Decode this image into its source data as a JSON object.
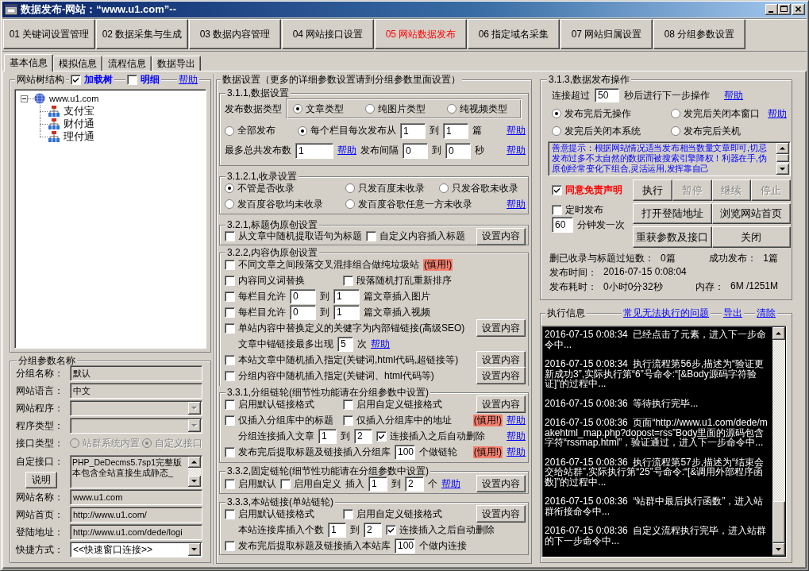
{
  "window": {
    "title": "数据发布-网站：“www.u1.com”--"
  },
  "module_tabs": [
    {
      "label": "01 关键词设置管理",
      "selected": false
    },
    {
      "label": "02 数据采集与生成",
      "selected": false
    },
    {
      "label": "03 数据内容管理",
      "selected": false
    },
    {
      "label": "04 网站接口设置",
      "selected": false
    },
    {
      "label": "05 网站数据发布",
      "selected": true
    },
    {
      "label": "06 指定域名采集",
      "selected": false
    },
    {
      "label": "07 网站归属设置",
      "selected": false
    },
    {
      "label": "08 分组参数设置",
      "selected": false
    }
  ],
  "tabs": [
    {
      "label": "基本信息",
      "selected": true
    },
    {
      "label": "模拟信息",
      "selected": false
    },
    {
      "label": "流程信息",
      "selected": false
    },
    {
      "label": "数据导出",
      "selected": false
    }
  ],
  "site_tree": {
    "title": "网站树结构",
    "options": [
      {
        "label": "加载树",
        "checked": true
      },
      {
        "label": "明细",
        "checked": false
      }
    ],
    "help": "帮助",
    "nodes": [
      {
        "label": "www.u1.com",
        "expanded": true,
        "children": [
          {
            "label": "支付宝"
          },
          {
            "label": "财付通"
          },
          {
            "label": "理付通"
          }
        ]
      }
    ]
  },
  "group_params": {
    "title": "分组参数名称",
    "fields": [
      {
        "kind": "text",
        "label": "分组名称：",
        "value": "默认",
        "readonly": true
      },
      {
        "kind": "text",
        "label": "网站语言：",
        "value": "中文",
        "readonly": true
      },
      {
        "kind": "select",
        "label": "网站程序：",
        "disabled": true
      },
      {
        "kind": "select",
        "label": "程序类型：",
        "disabled": true
      },
      {
        "kind": "radios",
        "label": "接口类型：",
        "disabled": true,
        "options": [
          {
            "label": "站群系统内置",
            "selected": false
          },
          {
            "label": "自定义接口",
            "selected": true
          }
        ]
      },
      {
        "kind": "memo",
        "label": "自定接口：",
        "lines": [
          "PHP_DeDecms5.7sp1完整版",
          "本包含全站直接生成静态_"
        ],
        "readonly": true,
        "button": "说明"
      },
      {
        "kind": "text",
        "label": "网站名称：",
        "value": "www.u1.com",
        "readonly": true
      },
      {
        "kind": "text",
        "label": "网站首页：",
        "value": "http://www.u1.com/",
        "readonly": true
      },
      {
        "kind": "text",
        "label": "登陆地址：",
        "value": "http://www.u1.com/dede/logi",
        "readonly": true
      },
      {
        "kind": "select",
        "label": "快捷方式：",
        "value": "<<快速窗口连接>>",
        "disabled": false
      }
    ]
  },
  "data_settings": {
    "title": "数据设置（更多的详细参数设置请到分组参数里面设置）",
    "sections": [
      {
        "title": "3.1.1,数据设置",
        "rows": [
          {
            "items": [
              {
                "kind": "label",
                "text": "发布数据类型"
              },
              {
                "kind": "radio_group",
                "options": [
                  {
                    "label": "文章类型",
                    "selected": true
                  },
                  {
                    "label": "纯图片类型",
                    "selected": false
                  },
                  {
                    "label": "纯视频类型",
                    "selected": false
                  }
                ]
              }
            ]
          },
          {
            "items": [
              {
                "kind": "radio",
                "label": "全部发布",
                "selected": false
              },
              {
                "kind": "radio",
                "label": "每个栏目每次发布从",
                "selected": true
              },
              {
                "kind": "input",
                "value": "1"
              },
              {
                "kind": "label",
                "text": "到"
              },
              {
                "kind": "input",
                "value": "1"
              },
              {
                "kind": "label",
                "text": "篇"
              },
              {
                "kind": "link",
                "text": "帮助"
              }
            ]
          },
          {
            "items": [
              {
                "kind": "label",
                "text": "最多总共发布数"
              },
              {
                "kind": "input",
                "value": "1"
              },
              {
                "kind": "link",
                "text": "帮助"
              },
              {
                "kind": "label",
                "text": "发布间隔"
              },
              {
                "kind": "input",
                "value": "0"
              },
              {
                "kind": "label",
                "text": "到"
              },
              {
                "kind": "input",
                "value": "0"
              },
              {
                "kind": "label",
                "text": "秒"
              },
              {
                "kind": "link",
                "text": "帮助"
              }
            ]
          }
        ]
      },
      {
        "title": "3.1.2.1,收录设置",
        "rows": [
          {
            "items": [
              {
                "kind": "radio",
                "label": "不管是否收录",
                "selected": true
              },
              {
                "kind": "radio",
                "label": "只发百度未收录",
                "selected": false
              },
              {
                "kind": "radio",
                "label": "只发谷歌未收录",
                "selected": false
              }
            ]
          },
          {
            "items": [
              {
                "kind": "radio",
                "label": "发百度谷歌均未收录",
                "selected": false
              },
              {
                "kind": "radio",
                "label": "发百度谷歌任意一方未收录",
                "selected": false
              },
              {
                "kind": "link",
                "text": "帮助"
              }
            ]
          }
        ]
      },
      {
        "title": "3.2.1,标题伪原创设置",
        "rows": [
          {
            "items": [
              {
                "kind": "checkbox",
                "label": "从文章中随机提取语句为标题",
                "checked": false
              },
              {
                "kind": "checkbox",
                "label": "自定义内容插入标题",
                "checked": false
              },
              {
                "kind": "button",
                "label": "设置内容"
              }
            ]
          }
        ]
      },
      {
        "title": "3.2.2,内容伪原创设置",
        "rows": [
          {
            "items": [
              {
                "kind": "checkbox",
                "label": "不同文章之间段落交叉混排组合做纯垃圾站",
                "checked": false
              },
              {
                "kind": "warning",
                "text": "(慎用!)"
              }
            ]
          },
          {
            "items": [
              {
                "kind": "checkbox",
                "label": "内容同义词替换",
                "checked": false
              },
              {
                "kind": "checkbox",
                "label": "段落随机打乱重新排序",
                "checked": false
              }
            ]
          },
          {
            "items": [
              {
                "kind": "checkbox",
                "label": "每栏目允许",
                "checked": false
              },
              {
                "kind": "input",
                "value": "0"
              },
              {
                "kind": "label",
                "text": "到"
              },
              {
                "kind": "input",
                "value": "1"
              },
              {
                "kind": "label",
                "text": "篇文章插入图片"
              }
            ]
          },
          {
            "items": [
              {
                "kind": "checkbox",
                "label": "每栏目允许",
                "checked": false
              },
              {
                "kind": "input",
                "value": "0"
              },
              {
                "kind": "label",
                "text": "到"
              },
              {
                "kind": "input",
                "value": "1"
              },
              {
                "kind": "label",
                "text": "篇文章插入视频"
              }
            ]
          },
          {
            "items": [
              {
                "kind": "checkbox",
                "label": "单站内容中替换定义的关健字为内部锚链接(高级SEO)",
                "checked": false
              },
              {
                "kind": "button",
                "label": "设置内容"
              }
            ]
          },
          {
            "items": [
              {
                "kind": "label",
                "text": "文章中锚链接最多出现"
              },
              {
                "kind": "input",
                "value": "5"
              },
              {
                "kind": "label",
                "text": "次"
              },
              {
                "kind": "link",
                "text": "帮助"
              }
            ]
          },
          {
            "items": [
              {
                "kind": "checkbox",
                "label": "本站文章中随机插入指定(关键词,html代码,超链接等)",
                "checked": false
              },
              {
                "kind": "button",
                "label": "设置内容"
              }
            ]
          },
          {
            "items": [
              {
                "kind": "checkbox",
                "label": "分组内容中随机插入指定(关键词、html代码等)",
                "checked": false
              },
              {
                "kind": "button",
                "label": "设置内容"
              }
            ]
          }
        ]
      },
      {
        "title": "3.3.1,分组链轮(细节性功能请在分组参数中设置)",
        "rows": [
          {
            "items": [
              {
                "kind": "checkbox",
                "label": "启用默认链接格式",
                "checked": false
              },
              {
                "kind": "checkbox",
                "label": "启用自定义链接格式",
                "checked": false
              },
              {
                "kind": "button",
                "label": "设置内容"
              }
            ]
          },
          {
            "items": [
              {
                "kind": "checkbox",
                "label": "仅插入分组库中的标题",
                "checked": false
              },
              {
                "kind": "checkbox",
                "label": "仅插入分组库中的地址",
                "checked": false
              },
              {
                "kind": "warning",
                "text": "(慎用!)"
              },
              {
                "kind": "link",
                "text": "帮助"
              }
            ]
          },
          {
            "items": [
              {
                "kind": "label",
                "text": "分组连接插入文章"
              },
              {
                "kind": "input",
                "value": "1"
              },
              {
                "kind": "label",
                "text": "到"
              },
              {
                "kind": "input",
                "value": "2"
              },
              {
                "kind": "checkbox",
                "label": "连接插入之后自动删除",
                "checked": true
              },
              {
                "kind": "link",
                "text": "帮助"
              }
            ]
          },
          {
            "items": [
              {
                "kind": "checkbox",
                "label": "发布完后提取标题及链接插入分组库",
                "checked": false
              },
              {
                "kind": "input",
                "value": "100"
              },
              {
                "kind": "label",
                "text": "个做链轮"
              },
              {
                "kind": "warning",
                "text": "(慎用!)"
              },
              {
                "kind": "link",
                "text": "帮助"
              }
            ]
          }
        ]
      },
      {
        "title": "3.3.2,固定链轮(细节性功能请在分组参数中设置)",
        "rows": [
          {
            "items": [
              {
                "kind": "checkbox",
                "label": "启用默认",
                "checked": false
              },
              {
                "kind": "checkbox",
                "label": "启用自定义",
                "checked": false
              },
              {
                "kind": "label",
                "text": "插入"
              },
              {
                "kind": "input",
                "value": "1"
              },
              {
                "kind": "label",
                "text": "到"
              },
              {
                "kind": "input",
                "value": "2"
              },
              {
                "kind": "label",
                "text": "个"
              },
              {
                "kind": "link",
                "text": "帮助"
              },
              {
                "kind": "button",
                "label": "设置内容"
              }
            ]
          }
        ]
      },
      {
        "title": "3.3.3,本站链接(单站链轮)",
        "rows": [
          {
            "items": [
              {
                "kind": "checkbox",
                "label": "启用默认链接格式",
                "checked": false
              },
              {
                "kind": "checkbox",
                "label": "启用自定义链接格式",
                "checked": false
              },
              {
                "kind": "button",
                "label": "设置内容"
              }
            ]
          },
          {
            "items": [
              {
                "kind": "label",
                "text": "本站连接库插入个数"
              },
              {
                "kind": "input",
                "value": "1"
              },
              {
                "kind": "label",
                "text": "到"
              },
              {
                "kind": "input",
                "value": "2"
              },
              {
                "kind": "checkbox",
                "label": "连接插入之后自动删除",
                "checked": true
              }
            ]
          },
          {
            "items": [
              {
                "kind": "checkbox",
                "label": "发布完后提取标题及链接插入本站库",
                "checked": false
              },
              {
                "kind": "input",
                "value": "100"
              },
              {
                "kind": "label",
                "text": "个做内连接"
              }
            ]
          }
        ]
      }
    ]
  },
  "publish_ops": {
    "title": "3.1.3,数据发布操作",
    "timeout": {
      "label": "连接超过",
      "value": "50",
      "suffix": "秒后进行下一步操作",
      "help": "帮助"
    },
    "after_actions": [
      {
        "label": "发布完后无操作",
        "selected": true
      },
      {
        "label": "发完后关闭本窗口",
        "selected": false
      },
      {
        "label": "发完后关闭本系统",
        "selected": false
      },
      {
        "label": "发布完后关机",
        "selected": false
      }
    ],
    "after_help": "帮助",
    "tip": "善意提示：根据网站情况适当发布相当数量文章即可,切忌发布过多不太自然的数据而被搜索引擎降权！利器在手,伪原创经常变化下组合,灵活运用,发挥靠自己",
    "agree": {
      "label": "同意免责声明",
      "checked": true
    },
    "run_buttons": [
      {
        "label": "执行",
        "disabled": false
      },
      {
        "label": "暂停",
        "disabled": true
      },
      {
        "label": "继续",
        "disabled": true
      },
      {
        "label": "停止",
        "disabled": true
      }
    ],
    "schedule": {
      "label": "定时发布",
      "checked": false,
      "value": "60",
      "suffix": "分钟发一次"
    },
    "action_buttons": [
      {
        "label": "打开登陆地址"
      },
      {
        "label": "浏览网站首页"
      },
      {
        "label": "重获参数及接口"
      },
      {
        "label": "关闭"
      }
    ],
    "stats": [
      [
        {
          "label": "删已收录与标题过短数：",
          "value": "0篇"
        },
        {
          "label": "成功发布：",
          "value": "1篇"
        }
      ],
      [
        {
          "label": "发布时间：",
          "value": "2016-07-15 0:08:04"
        }
      ],
      [
        {
          "label": "发布耗时：",
          "value": "0小时0分32秒"
        },
        {
          "label": "内存：",
          "value": "6M /1251M"
        }
      ]
    ]
  },
  "log": {
    "title": "执行信息",
    "links": [
      "常见无法执行的问题",
      "导出",
      "清除"
    ],
    "entries": [
      {
        "time": "2016-07-15 0:08:34",
        "message": "已经点击了元素，进入下一步命令中..."
      },
      {
        "time": "2016-07-15 0:08:34",
        "message": "执行流程第56步,描述为“验证更新成功3”,实际执行第“6”号命令:“[&Body源码字符验证]”的过程中..."
      },
      {
        "time": "2016-07-15 0:08:36",
        "message": "等待执行完毕..."
      },
      {
        "time": "2016-07-15 0:08:36",
        "message": "页面“http://www.u1.com/dede/makehtml_map.php?dopost=rss”Body里面的源码包含字符“rssmap.html”，验证通过，进入下一步命令中..."
      },
      {
        "time": "2016-07-15 0:08:36",
        "message": "执行流程第57步,描述为“结束会交给站群”,实际执行第“25”号命令:“[&调用外部程序函数]”的过程中..."
      },
      {
        "time": "2016-07-15 0:08:36",
        "message": "“站群中最后执行函数”，进入站群衔接命令中..."
      },
      {
        "time": "2016-07-15 0:08:36",
        "message": "自定义流程执行完毕，进入站群的下一步命令中..."
      }
    ]
  }
}
